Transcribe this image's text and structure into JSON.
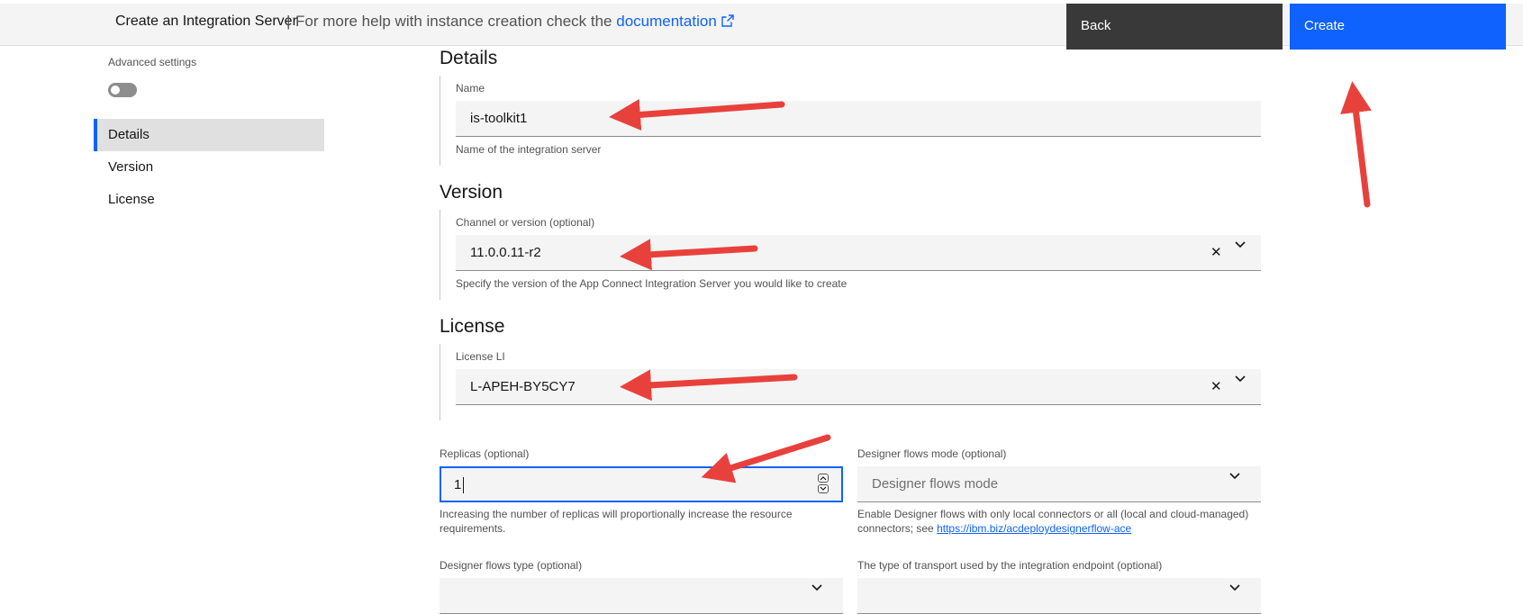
{
  "header": {
    "title": "Create an Integration Server",
    "separator": "|",
    "help_text": "For more help with instance creation check the",
    "help_link": "documentation",
    "back_label": "Back",
    "create_label": "Create"
  },
  "sidebar": {
    "advanced_label": "Advanced settings",
    "advanced_enabled": false,
    "items": [
      {
        "label": "Details",
        "active": true
      },
      {
        "label": "Version",
        "active": false
      },
      {
        "label": "License",
        "active": false
      }
    ]
  },
  "details": {
    "heading": "Details",
    "name_label": "Name",
    "name_value": "is-toolkit1",
    "name_helper": "Name of the integration server"
  },
  "version": {
    "heading": "Version",
    "channel_label": "Channel or version (optional)",
    "channel_value": "11.0.0.11-r2",
    "channel_helper": "Specify the version of the App Connect Integration Server you would like to create"
  },
  "license": {
    "heading": "License",
    "li_label": "License LI",
    "li_value": "L-APEH-BY5CY7"
  },
  "replicas": {
    "label": "Replicas (optional)",
    "value": "1",
    "helper_1": "Increasing the number of replicas will proportionally increase the resource",
    "helper_2": "requirements."
  },
  "designer_mode": {
    "label": "Designer flows mode (optional)",
    "placeholder": "Designer flows mode",
    "helper_1": "Enable Designer flows with only local connectors or all (local and cloud-managed)",
    "helper_2": "connectors; see",
    "helper_link": "https://ibm.biz/acdeploydesignerflow-ace"
  },
  "designer_type": {
    "label": "Designer flows type (optional)"
  },
  "transport": {
    "label": "The type of transport used by the integration endpoint (optional)"
  },
  "annotations": {
    "arrow_color": "#e8413c"
  },
  "colors": {
    "primary": "#0f62fe",
    "back_button": "#393939",
    "field_bg": "#f4f4f4"
  }
}
